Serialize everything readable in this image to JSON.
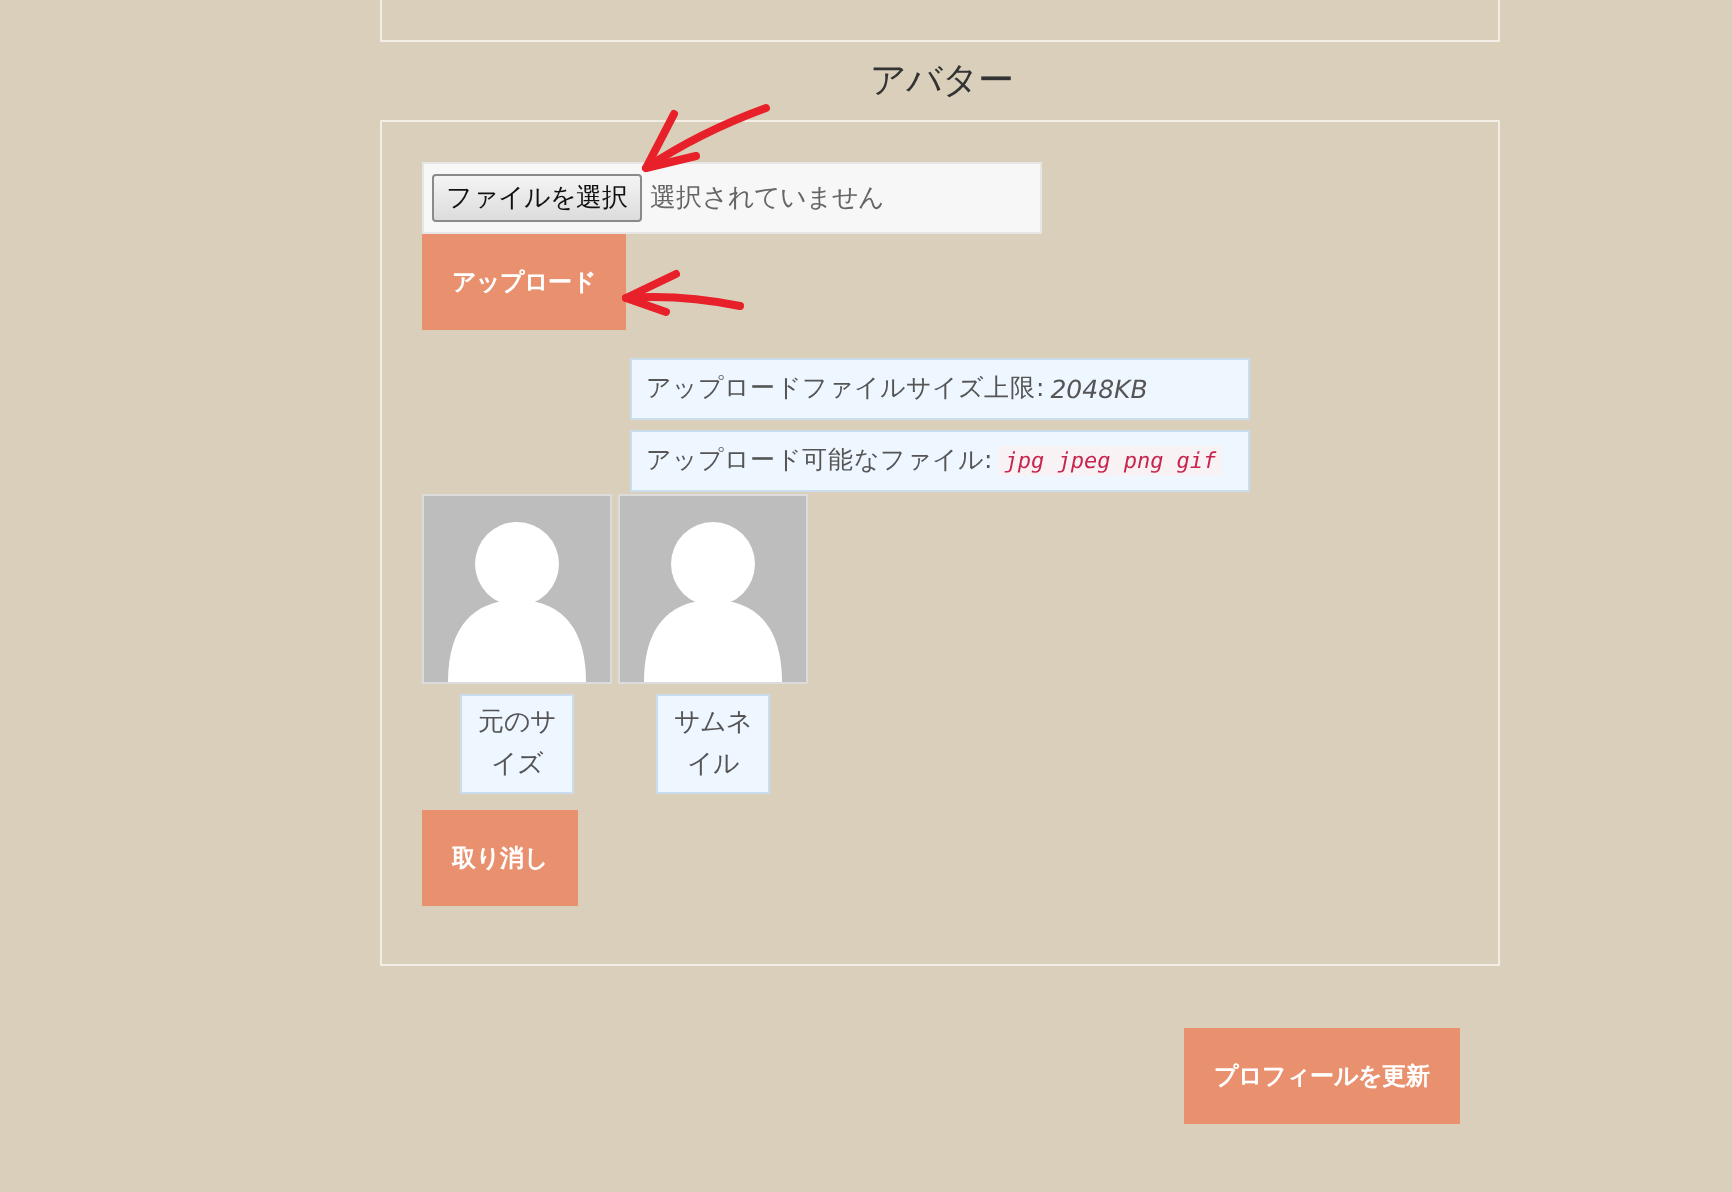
{
  "section_title": "アバター",
  "file_input": {
    "button": "ファイルを選択",
    "status": "選択されていません"
  },
  "upload_button": "アップロード",
  "info": [
    {
      "kind": "italic",
      "label": "アップロードファイルサイズ上限:",
      "value": "2048KB"
    },
    {
      "kind": "code",
      "label": "アップロード可能なファイル:",
      "value": "jpg jpeg png gif"
    }
  ],
  "avatars": [
    {
      "caption": "元のサイズ"
    },
    {
      "caption": "サムネイル"
    }
  ],
  "cancel_button": "取り消し",
  "update_button": "プロフィールを更新",
  "annotations": [
    {
      "kind": "arrow"
    },
    {
      "kind": "arrow"
    }
  ]
}
